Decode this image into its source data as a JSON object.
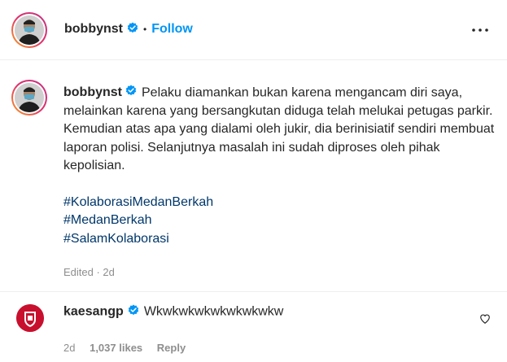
{
  "header": {
    "username": "bobbynst",
    "follow_label": "Follow",
    "separator": "•"
  },
  "caption": {
    "username": "bobbynst",
    "text": "Pelaku diamankan bukan karena mengancam diri saya, melainkan karena yang bersangkutan diduga telah melukai petugas parkir. Kemudian atas apa yang dialami oleh jukir, dia berinisiatif sendiri membuat laporan polisi. Selanjutnya masalah ini sudah diproses oleh pihak kepolisian.",
    "hashtags": [
      "#KolaborasiMedanBerkah",
      "#MedanBerkah",
      "#SalamKolaborasi"
    ],
    "meta": "Edited · 2d"
  },
  "comment": {
    "username": "kaesangp",
    "text": "Wkwkwkwkwkwkwkwkw",
    "time": "2d",
    "likes": "1,037 likes",
    "reply_label": "Reply"
  },
  "colors": {
    "accent": "#0095f6",
    "verified": "#0095f6",
    "hashtag": "#00376b",
    "muted": "#8e8e8e"
  }
}
